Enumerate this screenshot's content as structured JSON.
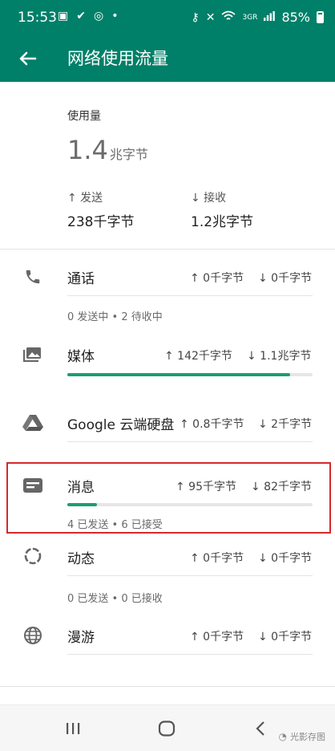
{
  "status_bar": {
    "time": "15:53",
    "network": "3GR",
    "battery": "85%"
  },
  "app_bar": {
    "title": "网络使用流量"
  },
  "usage": {
    "label": "使用量",
    "total_value": "1.4",
    "total_unit": "兆字节",
    "sent_label": "↑ 发送",
    "sent_value": "238千字节",
    "received_label": "↓ 接收",
    "received_value": "1.2兆字节"
  },
  "apps": [
    {
      "name": "通话",
      "up": "↑ 0千字节",
      "down": "↓ 0千字节",
      "sub": "0 发送中 • 2 待收中",
      "icon": "phone-icon"
    },
    {
      "name": "媒体",
      "up": "↑ 142千字节",
      "down": "↓ 1.1兆字节",
      "progress": 0.91,
      "icon": "media-icon"
    },
    {
      "name": "Google 云端硬盘",
      "up": "↑ 0.8千字节",
      "down": "↓ 2千字节",
      "icon": "google-drive-icon"
    },
    {
      "name": "消息",
      "up": "↑ 95千字节",
      "down": "↓ 82千字节",
      "progress": 0.12,
      "sub": "4 已发送 • 6 已接受",
      "icon": "message-icon"
    },
    {
      "name": "动态",
      "up": "↑ 0千字节",
      "down": "↓ 0千字节",
      "sub": "0 已发送 • 0 已接收",
      "icon": "status-icon"
    },
    {
      "name": "漫游",
      "up": "↑ 0千字节",
      "down": "↓ 0千字节",
      "icon": "globe-icon"
    }
  ],
  "watermark": "光影存图",
  "colors": {
    "brand": "#008069",
    "progress": "#1a9e72",
    "highlight": "#d42a2a"
  }
}
